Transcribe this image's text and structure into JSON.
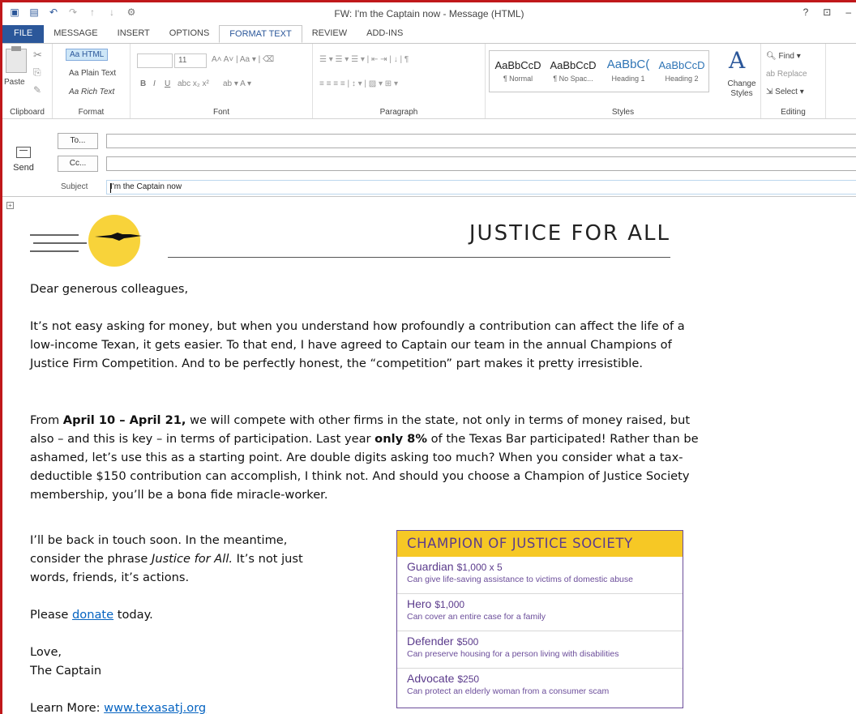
{
  "window": {
    "title": "FW: I'm the Captain now - Message (HTML)",
    "controls": [
      "?",
      "⊡",
      "–"
    ]
  },
  "qat_icons": [
    "outlook-icon",
    "save-icon",
    "undo-icon",
    "redo-icon",
    "up-icon",
    "down-icon",
    "customize-icon"
  ],
  "tabs": [
    {
      "label": "FILE"
    },
    {
      "label": "MESSAGE"
    },
    {
      "label": "INSERT"
    },
    {
      "label": "OPTIONS"
    },
    {
      "label": "FORMAT TEXT",
      "active": true
    },
    {
      "label": "REVIEW"
    },
    {
      "label": "ADD-INS"
    }
  ],
  "ribbon": {
    "clipboard": {
      "label": "Clipboard",
      "paste": "Paste"
    },
    "format": {
      "label": "Format",
      "html": "Aa HTML",
      "plain": "Aa Plain Text",
      "rich": "Aa Rich Text"
    },
    "font": {
      "label": "Font",
      "size": "11"
    },
    "paragraph": {
      "label": "Paragraph"
    },
    "styles": {
      "label": "Styles",
      "items": [
        {
          "sample": "AaBbCcD",
          "name": "¶ Normal"
        },
        {
          "sample": "AaBbCcD",
          "name": "¶ No Spac..."
        },
        {
          "sample": "AaBbC(",
          "name": "Heading 1"
        },
        {
          "sample": "AaBbCcD",
          "name": "Heading 2"
        }
      ],
      "change": "Change Styles"
    },
    "editing": {
      "label": "Editing",
      "find": "Find",
      "replace": "Replace",
      "select": "Select"
    }
  },
  "compose": {
    "send": "Send",
    "to_label": "To...",
    "cc_label": "Cc...",
    "subject_label": "Subject",
    "subject_value": "I'm the Captain now"
  },
  "banner": {
    "title": "JUSTICE FOR ALL"
  },
  "letter": {
    "greeting": "Dear generous colleagues,",
    "p1": "It’s not easy asking for money, but when you understand how profoundly a contribution can affect the life of a low-income Texan, it gets easier. To that end, I have agreed to Captain our team in the annual Champions of Justice Firm Competition. And to be perfectly honest, the “competition” part makes it pretty irresistible.",
    "p2_a": "From ",
    "p2_dates": "April 10 – April 21,",
    "p2_b": " we will compete with other firms in the state, not only in terms of money raised, but also – and this is key – in terms of participation. Last year ",
    "p2_pct": "only 8%",
    "p2_c": " of the Texas Bar participated! Rather than be ashamed, let’s use this as a starting point. Are double digits asking too much? When you consider what a tax-deductible $150 contribution can accomplish, I think not. And should you choose a Champion of Justice Society membership, you’ll be a bona fide miracle-worker.",
    "p3_a": "I’ll be back in touch soon. In the meantime, consider the phrase ",
    "p3_em": "Justice for All.",
    "p3_b": " It’s not just words, friends, it’s actions.",
    "p4_a": "Please ",
    "p4_link": "donate",
    "p4_b": " today.",
    "sign1": "Love,",
    "sign2": "The Captain",
    "learn_a": "Learn More: ",
    "learn_link": "www.texasatj.org"
  },
  "society": {
    "title": "CHAMPION OF JUSTICE SOCIETY",
    "tiers": [
      {
        "name": "Guardian",
        "amount": "$1,000 x 5",
        "desc": "Can give life-saving assistance to victims of domestic abuse"
      },
      {
        "name": "Hero",
        "amount": "$1,000",
        "desc": "Can cover an entire case for a family"
      },
      {
        "name": "Defender",
        "amount": "$500",
        "desc": "Can preserve housing for a person living with disabilities"
      },
      {
        "name": "Advocate",
        "amount": "$250",
        "desc": "Can protect an elderly woman from a consumer scam"
      }
    ]
  },
  "colors": {
    "accent": "#2b579a",
    "frame": "#c0181b",
    "society_yellow": "#f6c825",
    "society_purple": "#5b3b8c",
    "link": "#0563c1"
  }
}
